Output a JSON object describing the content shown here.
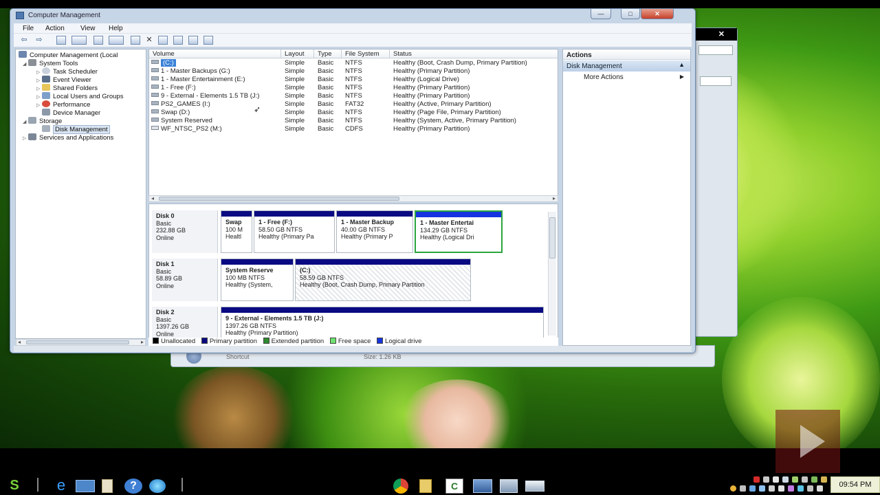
{
  "window": {
    "title": "Computer Management",
    "min_label": "—",
    "max_label": "□",
    "close_label": "✕"
  },
  "menu": [
    "File",
    "Action",
    "View",
    "Help"
  ],
  "toolbar": {
    "back": "⇦",
    "forward": "⇨",
    "delete": "✕"
  },
  "tree": [
    {
      "label": "Computer Management (Local",
      "expander": "",
      "depth": 0,
      "icon": "computer-icon"
    },
    {
      "label": "System Tools",
      "expander": "◢",
      "depth": 1,
      "icon": "tools-icon"
    },
    {
      "label": "Task Scheduler",
      "expander": "▷",
      "depth": 2,
      "icon": "clock-icon"
    },
    {
      "label": "Event Viewer",
      "expander": "▷",
      "depth": 2,
      "icon": "event-icon"
    },
    {
      "label": "Shared Folders",
      "expander": "▷",
      "depth": 2,
      "icon": "folder-icon"
    },
    {
      "label": "Local Users and Groups",
      "expander": "▷",
      "depth": 2,
      "icon": "users-icon"
    },
    {
      "label": "Performance",
      "expander": "▷",
      "depth": 2,
      "icon": "performance-icon"
    },
    {
      "label": "Device Manager",
      "expander": "",
      "depth": 2,
      "icon": "device-icon"
    },
    {
      "label": "Storage",
      "expander": "◢",
      "depth": 1,
      "icon": "storage-icon"
    },
    {
      "label": "Disk Management",
      "expander": "",
      "depth": 2,
      "icon": "disk-icon",
      "selected": true
    },
    {
      "label": "Services and Applications",
      "expander": "▷",
      "depth": 1,
      "icon": "services-icon"
    }
  ],
  "volume_columns": [
    "Volume",
    "Layout",
    "Type",
    "File System",
    "Status"
  ],
  "volumes": [
    {
      "volume": "(C:)",
      "layout": "Simple",
      "type": "Basic",
      "fs": "NTFS",
      "status": "Healthy (Boot, Crash Dump, Primary Partition)",
      "selected": true
    },
    {
      "volume": "1 - Master Backups (G:)",
      "layout": "Simple",
      "type": "Basic",
      "fs": "NTFS",
      "status": "Healthy (Primary Partition)"
    },
    {
      "volume": "1 - Master Entertainment (E:)",
      "layout": "Simple",
      "type": "Basic",
      "fs": "NTFS",
      "status": "Healthy (Logical Drive)"
    },
    {
      "volume": "1 - Free (F:)",
      "layout": "Simple",
      "type": "Basic",
      "fs": "NTFS",
      "status": "Healthy (Primary Partition)"
    },
    {
      "volume": "9 - External - Elements 1.5 TB (J:)",
      "layout": "Simple",
      "type": "Basic",
      "fs": "NTFS",
      "status": "Healthy (Primary Partition)"
    },
    {
      "volume": "PS2_GAMES (I:)",
      "layout": "Simple",
      "type": "Basic",
      "fs": "FAT32",
      "status": "Healthy (Active, Primary Partition)"
    },
    {
      "volume": "Swap (D:)",
      "layout": "Simple",
      "type": "Basic",
      "fs": "NTFS",
      "status": "Healthy (Page File, Primary Partition)"
    },
    {
      "volume": "System Reserved",
      "layout": "Simple",
      "type": "Basic",
      "fs": "NTFS",
      "status": "Healthy (System, Active, Primary Partition)"
    },
    {
      "volume": "WF_NTSC_PS2 (M:)",
      "layout": "Simple",
      "type": "Basic",
      "fs": "CDFS",
      "status": "Healthy (Primary Partition)"
    }
  ],
  "disks": [
    {
      "name": "Disk 0",
      "kind": "Basic",
      "size": "232.88 GB",
      "state": "Online",
      "partitions": [
        {
          "name": "Swap",
          "size": "100 M",
          "status": "Healtl",
          "style": "primary"
        },
        {
          "name": "1 - Free  (F:)",
          "size": "58.50 GB NTFS",
          "status": "Healthy (Primary Pa",
          "style": "primary"
        },
        {
          "name": "1 - Master Backup",
          "size": "40.00 GB NTFS",
          "status": "Healthy (Primary P",
          "style": "primary"
        },
        {
          "name": "1 - Master Entertai",
          "size": "134.29 GB NTFS",
          "status": "Healthy (Logical Dri",
          "style": "logical",
          "selected": true
        }
      ]
    },
    {
      "name": "Disk 1",
      "kind": "Basic",
      "size": "58.89 GB",
      "state": "Online",
      "partitions": [
        {
          "name": "System Reserve",
          "size": "100 MB NTFS",
          "status": "Healthy (System,",
          "style": "primary"
        },
        {
          "name": "(C:)",
          "size": "58.59 GB NTFS",
          "status": "Healthy (Boot, Crash Dump, Primary Partition",
          "style": "primary",
          "hatched": true
        }
      ]
    },
    {
      "name": "Disk 2",
      "kind": "Basic",
      "size": "1397.26 GB",
      "state": "Online",
      "partitions": [
        {
          "name": "9 - External - Elements 1.5 TB  (J:)",
          "size": "1397.26 GB NTFS",
          "status": "Healthy (Primary Partition)",
          "style": "primary"
        }
      ]
    }
  ],
  "legend": [
    {
      "label": "Unallocated",
      "color": "#000000"
    },
    {
      "label": "Primary partition",
      "color": "#0a0a82"
    },
    {
      "label": "Extended partition",
      "color": "#2e8b2e"
    },
    {
      "label": "Free space",
      "color": "#6fe36f"
    },
    {
      "label": "Logical drive",
      "color": "#1633e0"
    }
  ],
  "actions": {
    "header": "Actions",
    "section": "Disk Management",
    "item": "More Actions",
    "collapse": "▲",
    "more": "▶"
  },
  "back_window": {
    "close": "✕",
    "label1": "Shortcut",
    "label2": "Size: 1.26 KB"
  },
  "taskbar": {
    "clock": "09:54 PM"
  }
}
